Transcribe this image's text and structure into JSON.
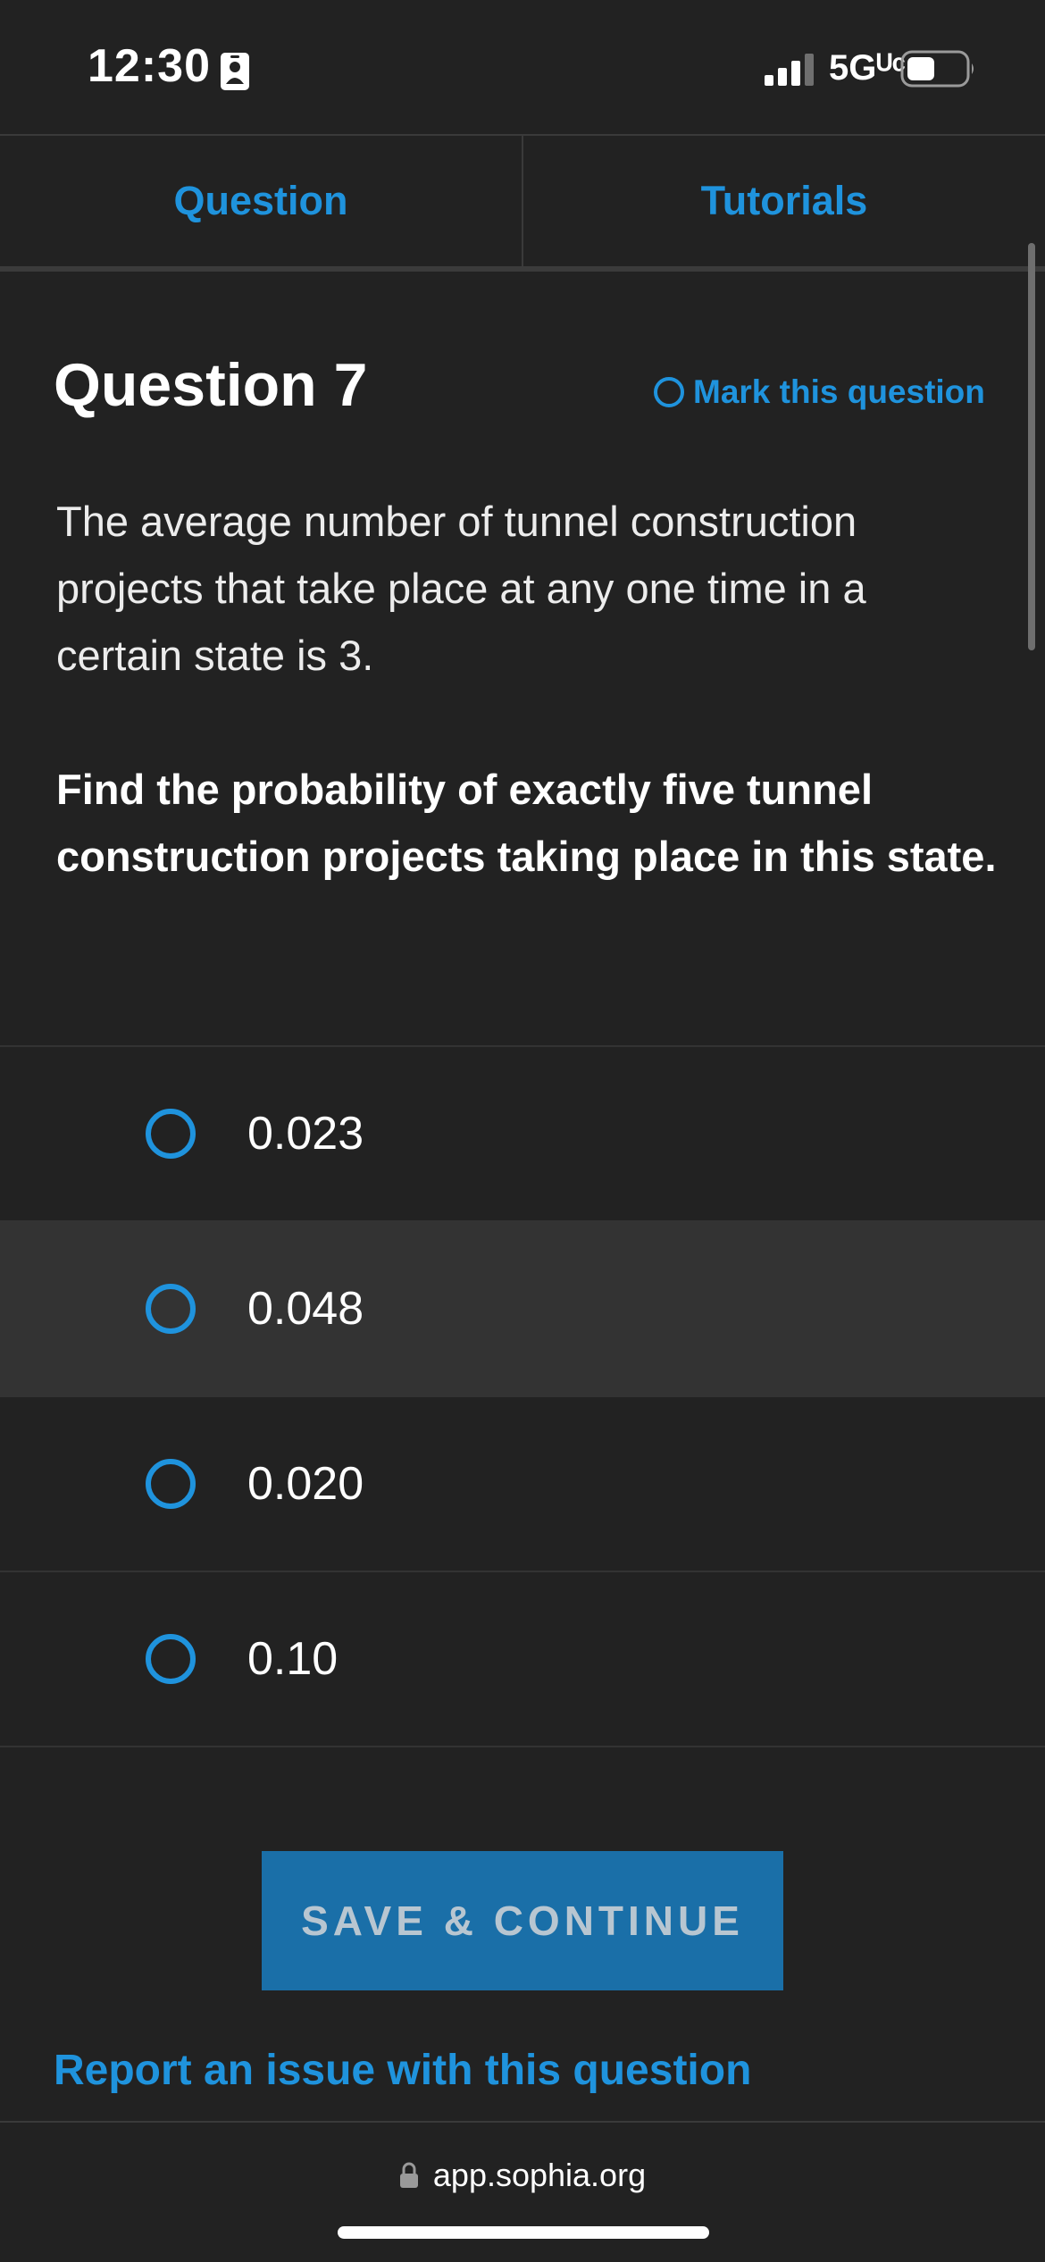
{
  "status_bar": {
    "time": "12:30",
    "network": "5Gᵁᶜ",
    "icons": [
      "contact-badge-icon",
      "signal-icon",
      "battery-icon"
    ]
  },
  "tabs": [
    {
      "label": "Question"
    },
    {
      "label": "Tutorials"
    }
  ],
  "question": {
    "title": "Question 7",
    "mark_label": "Mark this question",
    "prompt": "The average number of tunnel construction projects that take place at any one time in a certain state is 3.",
    "instruction": "Find the probability of exactly five tunnel construction projects taking place in this state."
  },
  "options": [
    {
      "label": "0.023"
    },
    {
      "label": "0.048"
    },
    {
      "label": "0.020"
    },
    {
      "label": "0.10"
    }
  ],
  "actions": {
    "save_label": "SAVE & CONTINUE",
    "report_label": "Report an issue with this question"
  },
  "browser": {
    "url": "app.sophia.org"
  },
  "colors": {
    "background": "#222222",
    "accent": "#1f93dd",
    "button": "#1a6fa8",
    "highlight_row": "#333333"
  }
}
